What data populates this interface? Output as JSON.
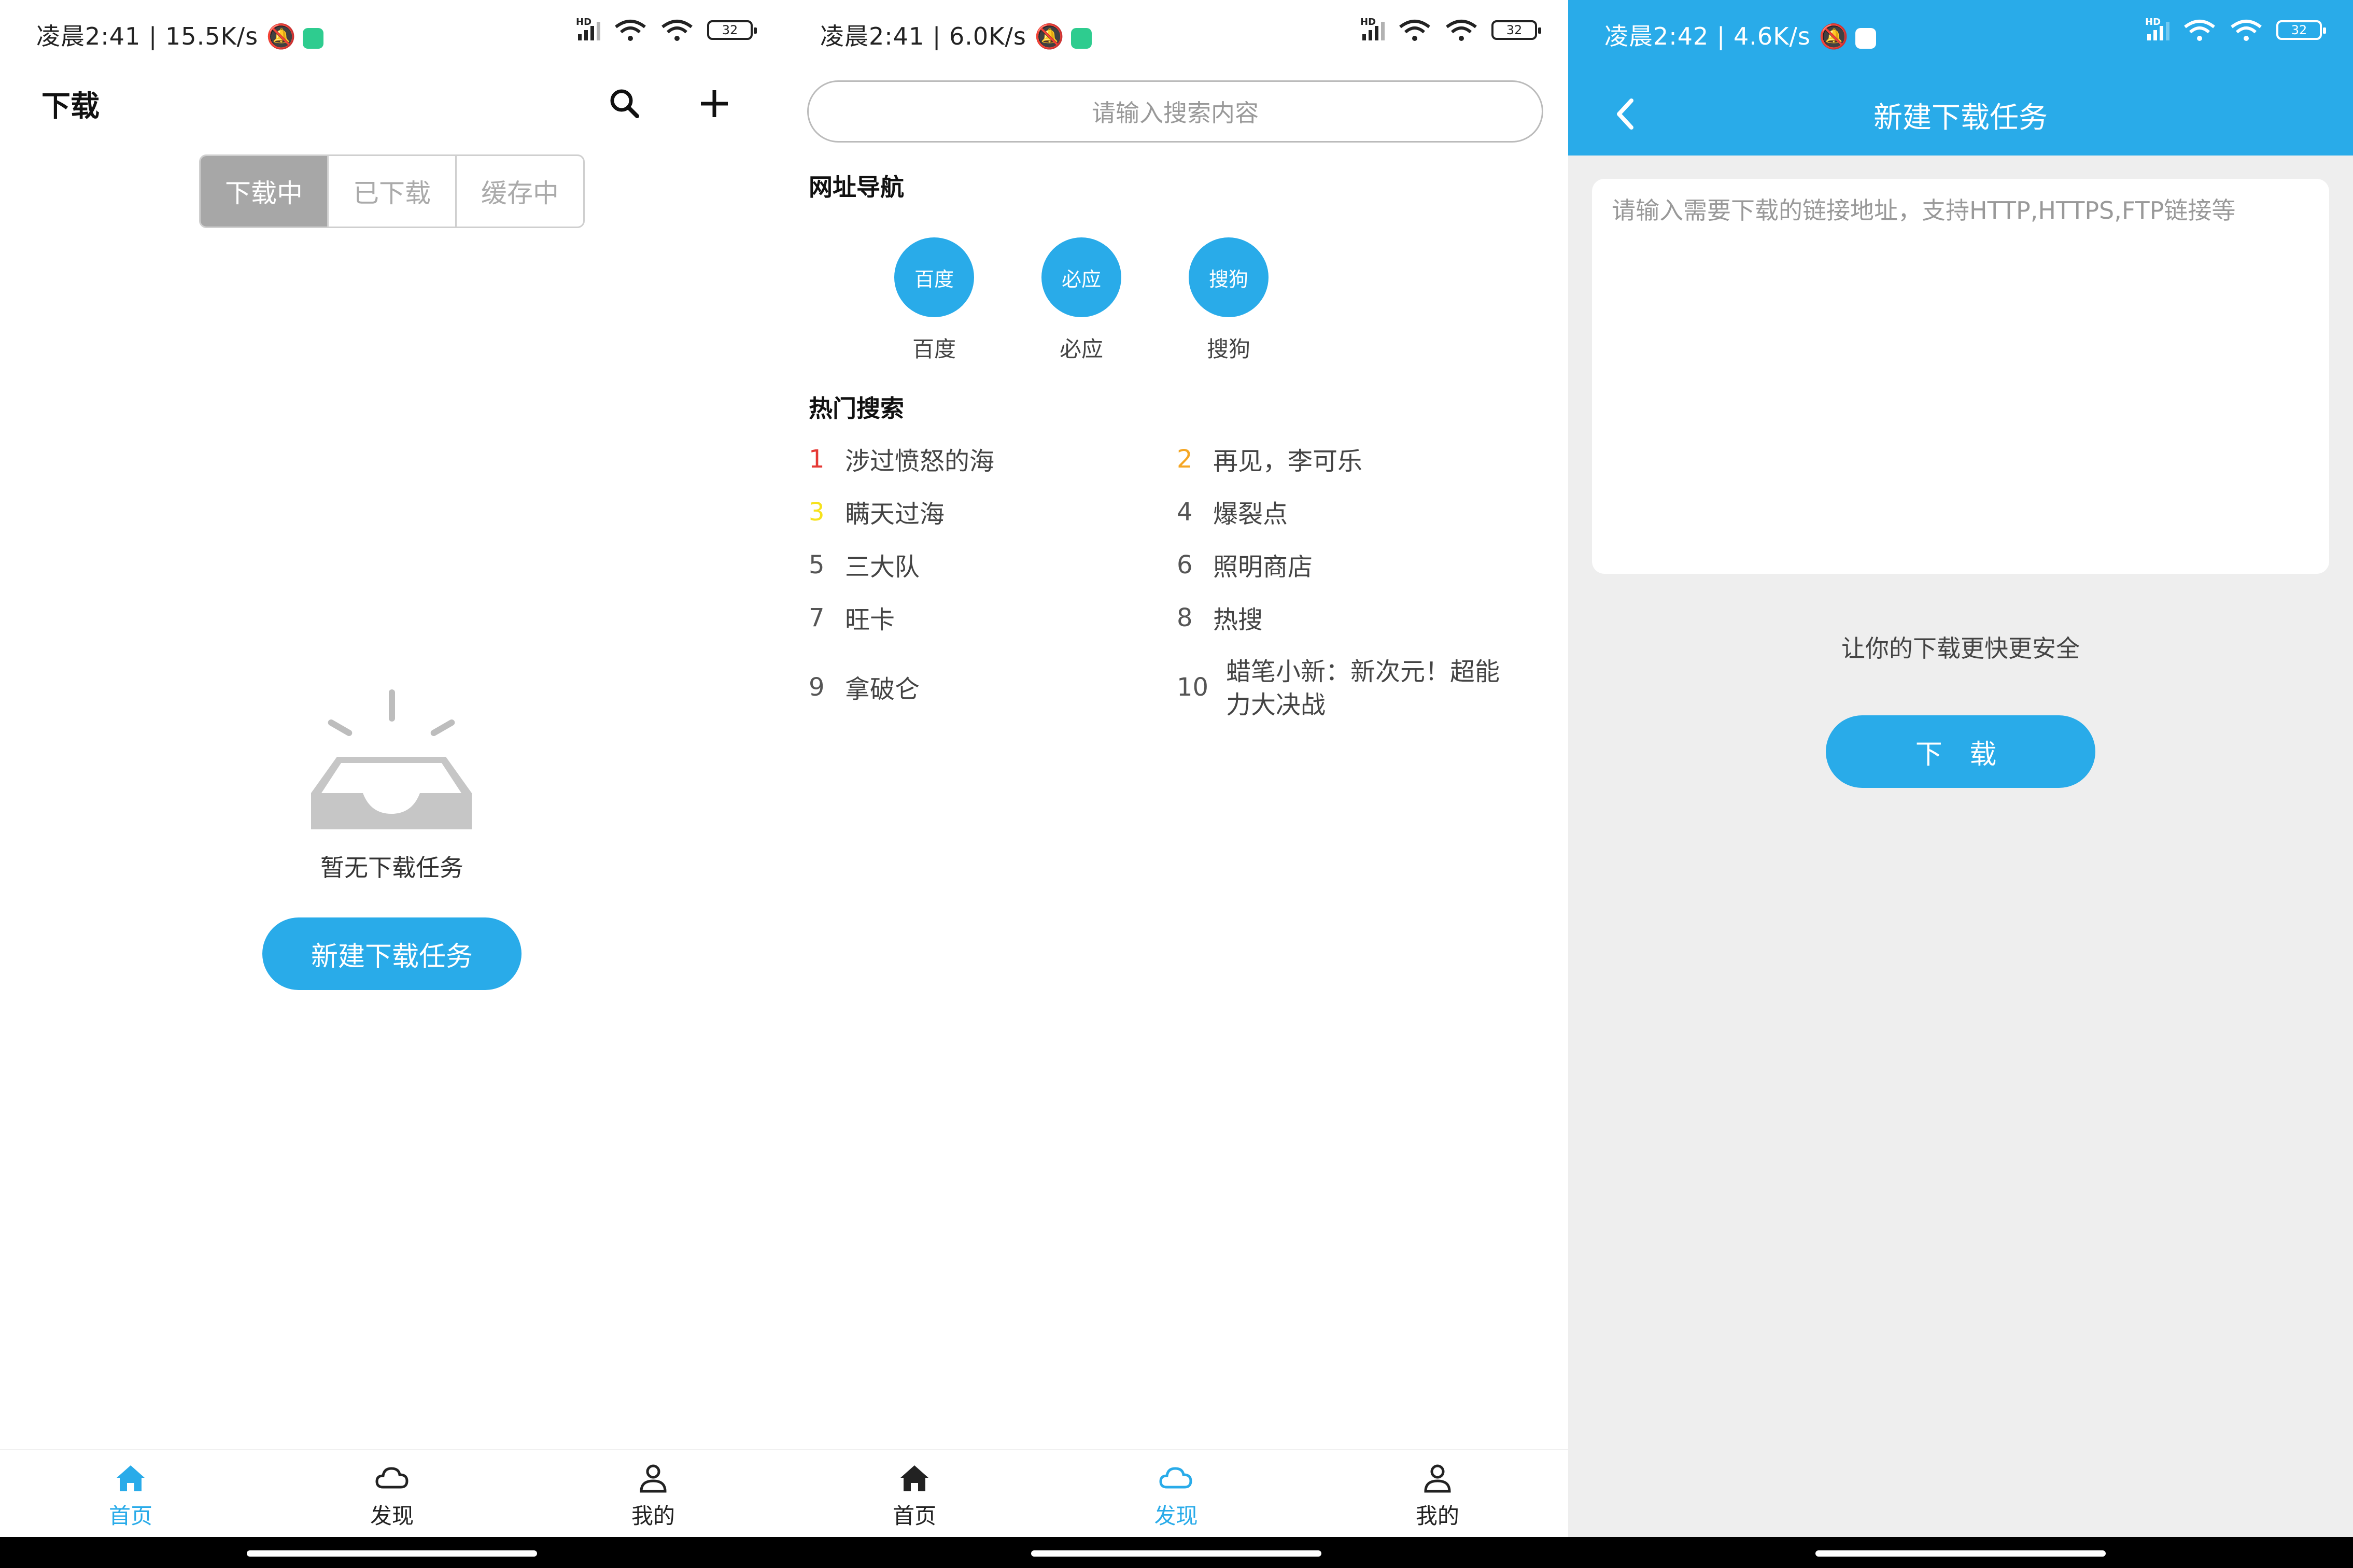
{
  "colors": {
    "accent": "#29abe9",
    "rank1": "#e53935",
    "rank2": "#f5a623",
    "rank3": "#f6e21c"
  },
  "panel1": {
    "status": {
      "time": "凌晨2:41 | 15.5K/s",
      "battery": "32"
    },
    "title": "下载",
    "tabs": [
      "下载中",
      "已下载",
      "缓存中"
    ],
    "empty_text": "暂无下载任务",
    "new_task_button": "新建下载任务",
    "nav": [
      {
        "label": "首页",
        "icon": "home-icon"
      },
      {
        "label": "发现",
        "icon": "cloud-icon"
      },
      {
        "label": "我的",
        "icon": "user-icon"
      }
    ]
  },
  "panel2": {
    "status": {
      "time": "凌晨2:41 | 6.0K/s",
      "battery": "32"
    },
    "search_placeholder": "请输入搜索内容",
    "nav_section_title": "网址导航",
    "sites": [
      {
        "circle": "百度",
        "label": "百度"
      },
      {
        "circle": "必应",
        "label": "必应"
      },
      {
        "circle": "搜狗",
        "label": "搜狗"
      }
    ],
    "hot_section_title": "热门搜索",
    "hot": [
      {
        "rank": "1",
        "text": "涉过愤怒的海"
      },
      {
        "rank": "2",
        "text": "再见，李可乐"
      },
      {
        "rank": "3",
        "text": "瞒天过海"
      },
      {
        "rank": "4",
        "text": "爆裂点"
      },
      {
        "rank": "5",
        "text": "三大队"
      },
      {
        "rank": "6",
        "text": "照明商店"
      },
      {
        "rank": "7",
        "text": "旺卡"
      },
      {
        "rank": "8",
        "text": "热搜"
      },
      {
        "rank": "9",
        "text": "拿破仑"
      },
      {
        "rank": "10",
        "text": "蜡笔小新：新次元！超能力大决战"
      }
    ],
    "nav": [
      {
        "label": "首页",
        "icon": "home-icon"
      },
      {
        "label": "发现",
        "icon": "cloud-icon"
      },
      {
        "label": "我的",
        "icon": "user-icon"
      }
    ]
  },
  "panel3": {
    "status": {
      "time": "凌晨2:42 | 4.6K/s",
      "battery": "32"
    },
    "title": "新建下载任务",
    "url_placeholder": "请输入需要下载的链接地址，支持HTTP,HTTPS,FTP链接等",
    "slogan": "让你的下载更快更安全",
    "download_button": "下 载"
  }
}
